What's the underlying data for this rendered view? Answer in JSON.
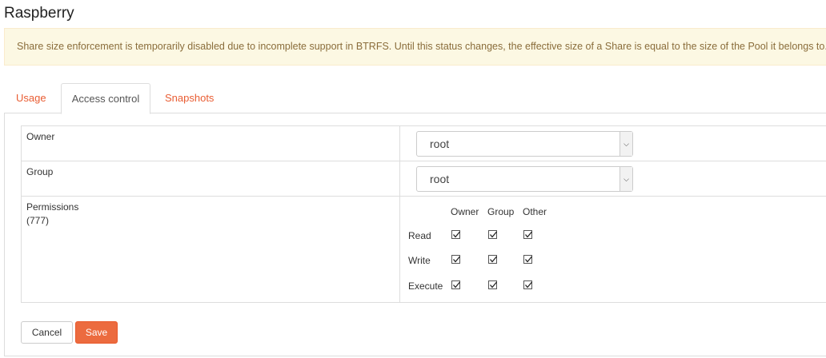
{
  "page": {
    "title": "Raspberry"
  },
  "alert": {
    "text": "Share size enforcement is temporarily disabled due to incomplete support in BTRFS. Until this status changes, the effective size of a Share is equal to the size of the Pool it belongs to."
  },
  "tabs": [
    {
      "label": "Usage",
      "active": false
    },
    {
      "label": "Access control",
      "active": true
    },
    {
      "label": "Snapshots",
      "active": false
    }
  ],
  "form": {
    "owner_label": "Owner",
    "owner_value": "root",
    "group_label": "Group",
    "group_value": "root",
    "permissions_label": "Permissions",
    "permissions_value": "(777)",
    "perm_columns": [
      "Owner",
      "Group",
      "Other"
    ],
    "perm_rows": [
      {
        "label": "Read",
        "checked": [
          true,
          true,
          true
        ]
      },
      {
        "label": "Write",
        "checked": [
          true,
          true,
          true
        ]
      },
      {
        "label": "Execute",
        "checked": [
          true,
          true,
          true
        ]
      }
    ]
  },
  "actions": {
    "cancel_label": "Cancel",
    "save_label": "Save"
  },
  "colors": {
    "accent": "#ec6b3f",
    "tab_link": "#e95d33",
    "alert_bg": "#fcf8e3",
    "alert_text": "#8a6d3b"
  },
  "icons": {
    "select_arrow": "chevron-down-icon",
    "checkbox": "checkmark-icon"
  }
}
